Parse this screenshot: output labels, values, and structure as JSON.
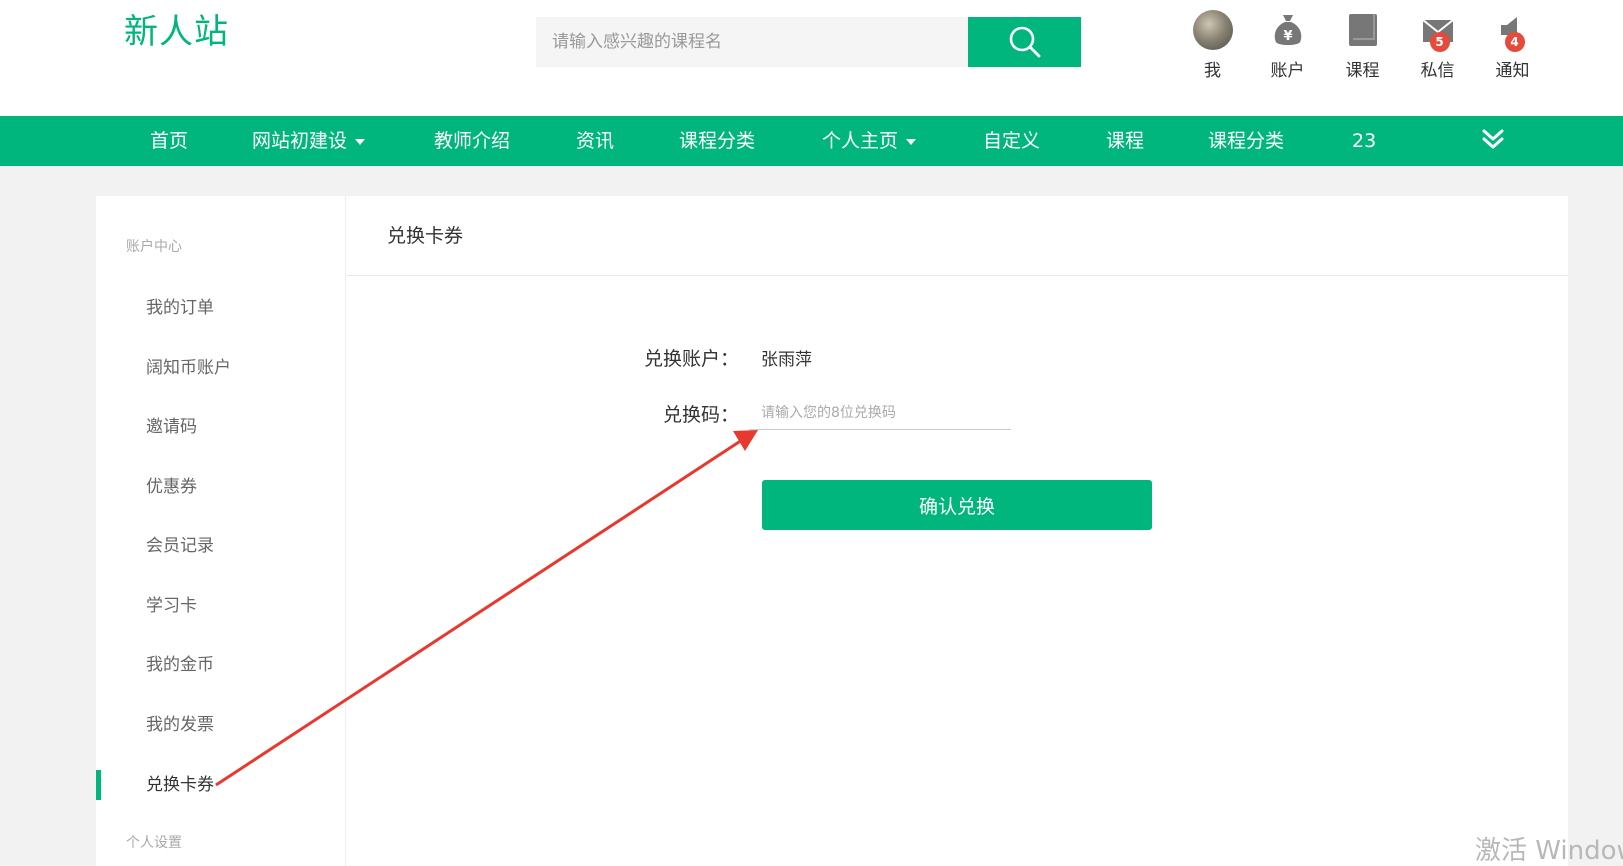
{
  "header": {
    "logo": "新人站",
    "search": {
      "placeholder": "请输入感兴趣的课程名"
    },
    "user_menu": [
      {
        "label": "我",
        "icon": "avatar"
      },
      {
        "label": "账户",
        "icon": "money-bag-icon"
      },
      {
        "label": "课程",
        "icon": "book-icon"
      },
      {
        "label": "私信",
        "icon": "mail-icon",
        "badge": "5"
      },
      {
        "label": "通知",
        "icon": "speaker-icon",
        "badge": "4"
      }
    ]
  },
  "nav": {
    "items": [
      {
        "label": "首页"
      },
      {
        "label": "网站初建设",
        "dropdown": true
      },
      {
        "label": "教师介绍"
      },
      {
        "label": "资讯"
      },
      {
        "label": "课程分类"
      },
      {
        "label": "个人主页",
        "dropdown": true
      },
      {
        "label": "自定义"
      },
      {
        "label": "课程"
      },
      {
        "label": "课程分类"
      },
      {
        "label": "23"
      }
    ],
    "more_icon": "double-chevron-down-icon"
  },
  "sidebar": {
    "group1": "账户中心",
    "items": [
      {
        "label": "我的订单"
      },
      {
        "label": "阔知币账户"
      },
      {
        "label": "邀请码"
      },
      {
        "label": "优惠券"
      },
      {
        "label": "会员记录"
      },
      {
        "label": "学习卡"
      },
      {
        "label": "我的金币"
      },
      {
        "label": "我的发票"
      },
      {
        "label": "兑换卡券"
      }
    ],
    "active_item": "兑换卡券",
    "group2": "个人设置"
  },
  "content": {
    "title": "兑换卡券",
    "account_label": "兑换账户：",
    "account_value": "张雨萍",
    "code_label": "兑换码：",
    "code_placeholder": "请输入您的8位兑换码",
    "confirm_label": "确认兑换"
  },
  "watermark": "激活 Windows",
  "colors": {
    "brand": "#00b67c",
    "badge": "#e64a3b",
    "annotation_arrow": "#e8392f"
  }
}
